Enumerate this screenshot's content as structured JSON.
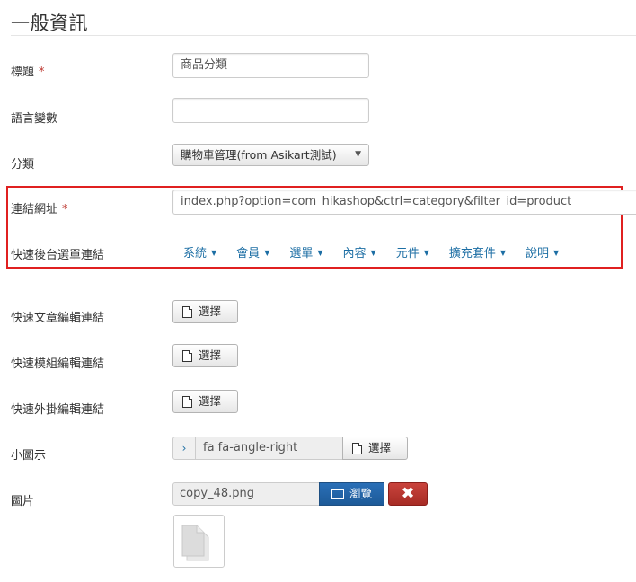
{
  "section_title": "一般資訊",
  "fields": {
    "title_label": "標題",
    "title_value": "商品分類",
    "lang_label": "語言變數",
    "lang_value": "",
    "category_label": "分類",
    "category_value": "購物車管理(from Asikart測試)",
    "link_label": "連結網址",
    "link_value": "index.php?option=com_hikashop&ctrl=category&filter_id=product",
    "quick_admin_label": "快速後台選單連結",
    "quick_article_label": "快速文章編輯連結",
    "quick_module_label": "快速模組編輯連結",
    "quick_plugin_label": "快速外掛編輯連結",
    "icon_label": "小圖示",
    "icon_value": "fa fa-angle-right",
    "image_label": "圖片",
    "image_value": "copy_48.png"
  },
  "required_mark": "*",
  "menu_items": [
    "系統",
    "會員",
    "選單",
    "內容",
    "元件",
    "擴充套件",
    "說明"
  ],
  "buttons": {
    "select": "選擇",
    "browse": "瀏覽",
    "clear": "✖"
  },
  "colors": {
    "link_blue": "#1c6ea4",
    "required_red": "#bd362f",
    "highlight_red": "#e02020",
    "browse_blue": "#1d5a98",
    "clear_red": "#b0332c"
  }
}
